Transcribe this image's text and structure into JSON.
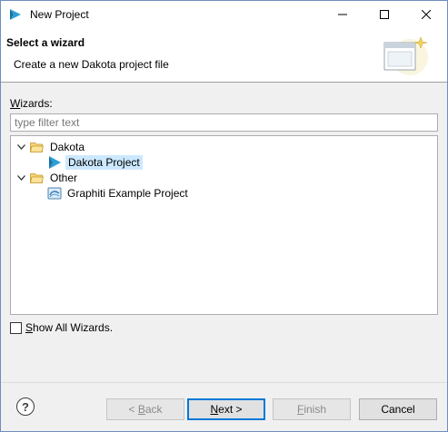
{
  "window": {
    "title": "New Project",
    "controls": {
      "minimize_icon": "minimize-icon",
      "maximize_icon": "maximize-icon",
      "close_icon": "close-icon"
    }
  },
  "banner": {
    "title": "Select a wizard",
    "description": "Create a new Dakota project file"
  },
  "wizards": {
    "label_mnemonic": "W",
    "label_rest": "izards:",
    "filter_placeholder": "type filter text",
    "tree": [
      {
        "label": "Dakota",
        "expanded": true,
        "children": [
          {
            "label": "Dakota Project",
            "selected": true
          }
        ]
      },
      {
        "label": "Other",
        "expanded": true,
        "children": [
          {
            "label": "Graphiti Example Project",
            "selected": false
          }
        ]
      }
    ]
  },
  "show_all": {
    "mnemonic": "S",
    "rest": "how All Wizards.",
    "checked": false
  },
  "buttons": {
    "help": "?",
    "back_prefix": "< ",
    "back_mnemonic": "B",
    "back_rest": "ack",
    "next_mnemonic": "N",
    "next_rest": "ext >",
    "finish_mnemonic": "F",
    "finish_rest": "inish",
    "cancel": "Cancel"
  },
  "colors": {
    "selection": "#cce8ff",
    "folder": "#e8b84b",
    "dakota_accent": "#2a9fd6",
    "default_button_border": "#0078d7"
  }
}
